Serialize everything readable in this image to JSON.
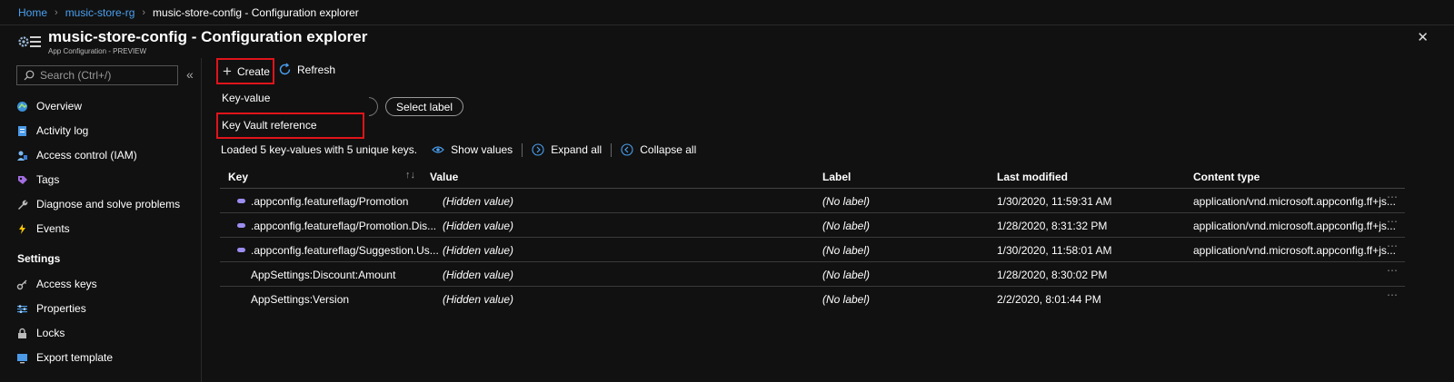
{
  "breadcrumb": {
    "home": "Home",
    "resource_group": "music-store-rg",
    "current": "music-store-config - Configuration explorer"
  },
  "header": {
    "title": "music-store-config - Configuration explorer",
    "subtitle": "App Configuration - PREVIEW",
    "close_icon": "close-icon"
  },
  "sidebar": {
    "search_placeholder": "Search (Ctrl+/)",
    "collapse": "«",
    "items": [
      {
        "label": "Overview",
        "icon": "overview-icon"
      },
      {
        "label": "Activity log",
        "icon": "activity-log-icon"
      },
      {
        "label": "Access control (IAM)",
        "icon": "iam-icon"
      },
      {
        "label": "Tags",
        "icon": "tag-icon"
      },
      {
        "label": "Diagnose and solve problems",
        "icon": "wrench-icon"
      },
      {
        "label": "Events",
        "icon": "lightning-icon"
      }
    ],
    "section_settings": "Settings",
    "settings_items": [
      {
        "label": "Access keys",
        "icon": "key-icon"
      },
      {
        "label": "Properties",
        "icon": "properties-icon"
      },
      {
        "label": "Locks",
        "icon": "lock-icon"
      },
      {
        "label": "Export template",
        "icon": "export-template-icon"
      }
    ]
  },
  "toolbar": {
    "create_label": "Create",
    "refresh_label": "Refresh"
  },
  "create_menu": {
    "items": [
      "Key-value",
      "Key Vault reference"
    ]
  },
  "filters": {
    "select_label": "Select label"
  },
  "status": {
    "loaded_text": "Loaded 5 key-values with 5 unique keys.",
    "show_values": "Show values",
    "expand_all": "Expand all",
    "collapse_all": "Collapse all"
  },
  "table": {
    "headers": {
      "key": "Key",
      "value": "Value",
      "label": "Label",
      "last_modified": "Last modified",
      "content_type": "Content type"
    },
    "rows": [
      {
        "key": ".appconfig.featureflag/Promotion",
        "value": "(Hidden value)",
        "label": "(No label)",
        "last_modified": "1/30/2020, 11:59:31 AM",
        "content_type": "application/vnd.microsoft.appconfig.ff+js...",
        "feature_flag": true
      },
      {
        "key": ".appconfig.featureflag/Promotion.Dis...",
        "value": "(Hidden value)",
        "label": "(No label)",
        "last_modified": "1/28/2020, 8:31:32 PM",
        "content_type": "application/vnd.microsoft.appconfig.ff+js...",
        "feature_flag": true
      },
      {
        "key": ".appconfig.featureflag/Suggestion.Us...",
        "value": "(Hidden value)",
        "label": "(No label)",
        "last_modified": "1/30/2020, 11:58:01 AM",
        "content_type": "application/vnd.microsoft.appconfig.ff+js...",
        "feature_flag": true
      },
      {
        "key": "AppSettings:Discount:Amount",
        "value": "(Hidden value)",
        "label": "(No label)",
        "last_modified": "1/28/2020, 8:30:02 PM",
        "content_type": "",
        "feature_flag": false
      },
      {
        "key": "AppSettings:Version",
        "value": "(Hidden value)",
        "label": "(No label)",
        "last_modified": "2/2/2020, 8:01:44 PM",
        "content_type": "",
        "feature_flag": false
      }
    ]
  },
  "colors": {
    "highlight": "#e0141b",
    "link": "#4aa0f0",
    "background": "#111111"
  }
}
